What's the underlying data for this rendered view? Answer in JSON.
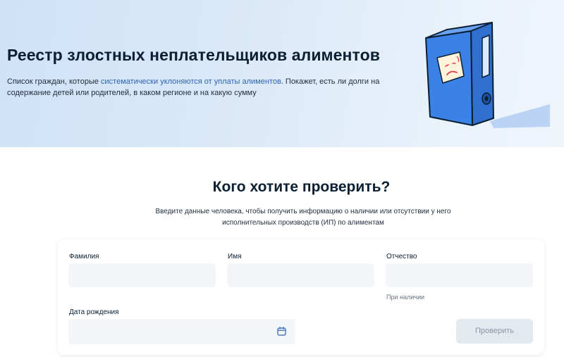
{
  "hero": {
    "title": "Реестр злостных неплательщиков алиментов",
    "desc_part1": "Список граждан, которые ",
    "desc_link": "систематически уклоняются от уплаты алиментов",
    "desc_part2": ". Покажет, есть ли долги на содержание детей или родителей, в каком регионе и на какую сумму",
    "illustration_icon": "blue-folder-sad-sticky-note-icon"
  },
  "check": {
    "title": "Кого хотите проверить?",
    "desc": "Введите данные человека, чтобы получить информацию о наличии или отсутствии у него исполнительных производств (ИП) по алиментам"
  },
  "form": {
    "surname_label": "Фамилия",
    "surname_value": "",
    "name_label": "Имя",
    "name_value": "",
    "patronymic_label": "Отчество",
    "patronymic_value": "",
    "patronymic_hint": "При наличии",
    "birthdate_label": "Дата рождения",
    "birthdate_value": "",
    "calendar_icon": "calendar-icon",
    "submit_label": "Проверить"
  },
  "colors": {
    "link": "#2d63b4",
    "folder_blue": "#3b7fe0",
    "button_disabled_bg": "#e4e8ef",
    "input_bg": "#f4f5f9"
  }
}
